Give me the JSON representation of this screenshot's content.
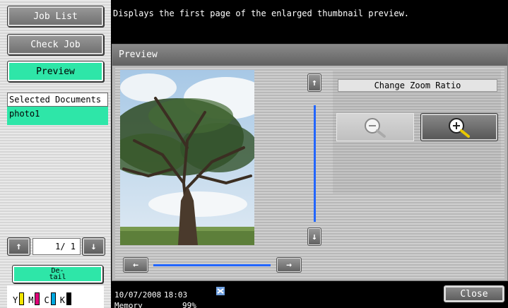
{
  "message": "Displays the first page of the enlarged thumbnail preview.",
  "left": {
    "job_list": "Job List",
    "check_job": "Check Job",
    "preview": "Preview",
    "selected_header": "Selected Documents",
    "selected_item": "photo1",
    "page_indicator": "1/ 1",
    "detail_line1": "De-",
    "detail_line2": "tail",
    "toner": [
      {
        "label": "Y",
        "color": "#f2e600"
      },
      {
        "label": "M",
        "color": "#e0007a"
      },
      {
        "label": "C",
        "color": "#00a8e0"
      },
      {
        "label": "K",
        "color": "#000000"
      }
    ]
  },
  "preview": {
    "title": "Preview",
    "zoom_label": "Change Zoom Ratio"
  },
  "footer": {
    "date": "10/07/2008",
    "time": "18:03",
    "memory_label": "Memory",
    "memory_value": "99%",
    "close": "Close"
  },
  "colors": {
    "accent": "#2ee6a8",
    "scroll_track": "#2266ff"
  },
  "icons": {
    "up": "arrow-up-icon",
    "down": "arrow-down-icon",
    "left": "arrow-left-icon",
    "right": "arrow-right-icon",
    "zoom_out": "zoom-out-icon",
    "zoom_in": "zoom-in-icon",
    "network": "network-icon"
  }
}
